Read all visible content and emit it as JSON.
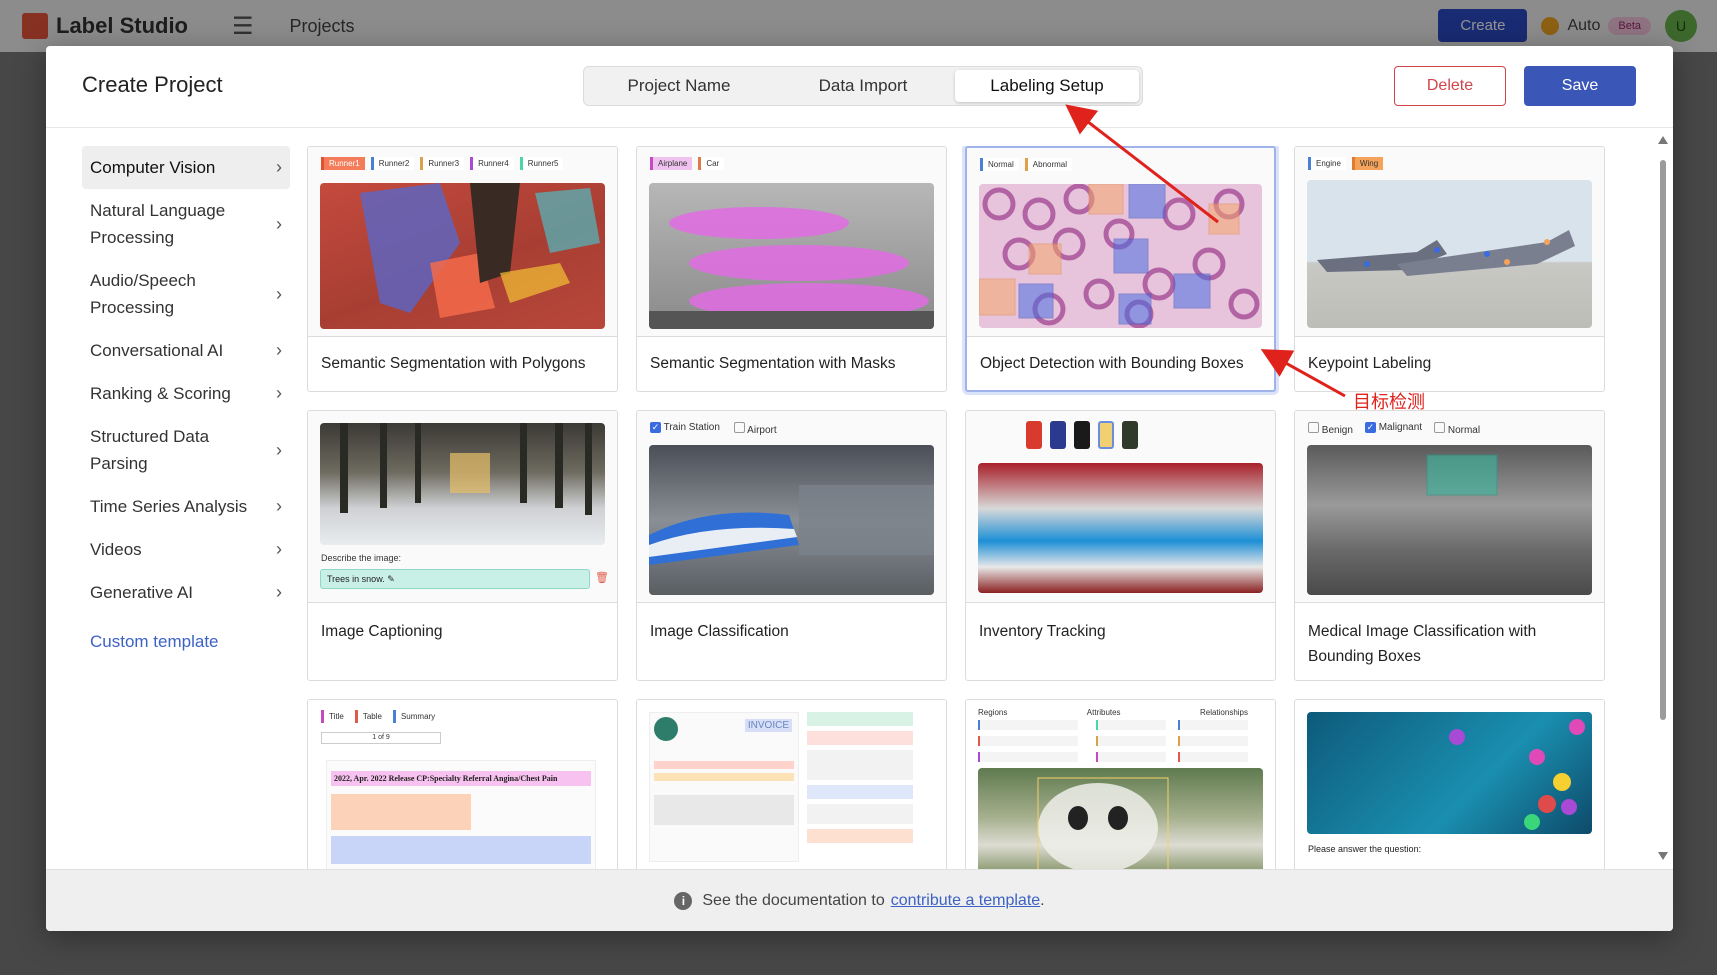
{
  "app": {
    "logo_text": "Label Studio",
    "projects_label": "Projects",
    "create_label": "Create",
    "auto_label": "Auto",
    "beta_label": "Beta",
    "avatar_initial": "U"
  },
  "modal": {
    "title": "Create Project",
    "tabs": [
      {
        "label": "Project Name",
        "active": false
      },
      {
        "label": "Data Import",
        "active": false
      },
      {
        "label": "Labeling Setup",
        "active": true
      }
    ],
    "delete_label": "Delete",
    "save_label": "Save"
  },
  "sidebar": {
    "categories": [
      {
        "label": "Computer Vision",
        "active": true
      },
      {
        "label": "Natural Language Processing",
        "active": false
      },
      {
        "label": "Audio/Speech Processing",
        "active": false
      },
      {
        "label": "Conversational AI",
        "active": false
      },
      {
        "label": "Ranking & Scoring",
        "active": false
      },
      {
        "label": "Structured Data Parsing",
        "active": false
      },
      {
        "label": "Time Series Analysis",
        "active": false
      },
      {
        "label": "Videos",
        "active": false
      },
      {
        "label": "Generative AI",
        "active": false
      }
    ],
    "custom_template_label": "Custom template"
  },
  "templates": [
    {
      "title": "Semantic Segmentation with Polygons",
      "tags": [
        "Runner1",
        "Runner2",
        "Runner3",
        "Runner4",
        "Runner5"
      ],
      "selected": false
    },
    {
      "title": "Semantic Segmentation with Masks",
      "tags": [
        "Airplane",
        "Car"
      ],
      "selected": false
    },
    {
      "title": "Object Detection with Bounding Boxes",
      "tags": [
        "Normal",
        "Abnormal"
      ],
      "selected": true
    },
    {
      "title": "Keypoint Labeling",
      "tags": [
        "Engine",
        "Wing"
      ],
      "selected": false
    },
    {
      "title": "Image Captioning",
      "caption_prompt": "Describe the image:",
      "caption_value": "Trees in snow.",
      "selected": false
    },
    {
      "title": "Image Classification",
      "choices": [
        "Train Station",
        "Airport"
      ],
      "selected": false
    },
    {
      "title": "Inventory Tracking",
      "selected": false
    },
    {
      "title": "Medical Image Classification with Bounding Boxes",
      "choices": [
        "Benign",
        "Malignant",
        "Normal"
      ],
      "selected": false
    },
    {
      "title": "",
      "tags": [
        "Title",
        "Table",
        "Summary"
      ],
      "pager": "1 of 9",
      "doc_heading": "2022, Apr. 2022 Release CP:Specialty Referral Angina/Chest Pain",
      "selected": false
    },
    {
      "title": "",
      "doc_text": "INVOICE",
      "selected": false
    },
    {
      "title": "",
      "columns": [
        "Regions",
        "Attributes",
        "Relationships"
      ],
      "selected": false
    },
    {
      "title": "",
      "question": "Please answer the question:",
      "selected": false
    }
  ],
  "footer": {
    "prefix": "See the documentation to",
    "link_text": "contribute a template",
    "suffix": "."
  },
  "annotation": {
    "label": "目标检测"
  },
  "colors": {
    "primary": "#3a57b7",
    "danger": "#d0454a",
    "link": "#3d62c5",
    "annotation": "#e0221c"
  }
}
